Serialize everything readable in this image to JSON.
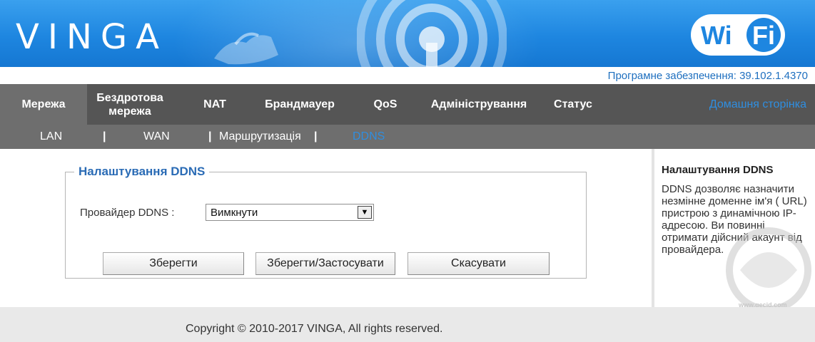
{
  "header": {
    "logo": "VINGA",
    "wifi_left": "Wi",
    "wifi_right": "Fi"
  },
  "version": "Програмне забезпечення: 39.102.1.4370",
  "nav": {
    "items": [
      {
        "label": "Мережа"
      },
      {
        "label": "Бездротова мережа"
      },
      {
        "label": "NAT"
      },
      {
        "label": "Брандмауер"
      },
      {
        "label": "QoS"
      },
      {
        "label": "Адміністрування"
      },
      {
        "label": "Статус"
      }
    ],
    "home": "Домашня сторінка"
  },
  "subnav": {
    "items": [
      {
        "label": "LAN"
      },
      {
        "label": "WAN"
      },
      {
        "label": "Маршрутизація"
      },
      {
        "label": "DDNS"
      }
    ],
    "separator": "|"
  },
  "form": {
    "legend": "Налаштування DDNS",
    "provider_label": "Провайдер DDNS :",
    "provider_value": "Вимкнути",
    "save": "Зберегти",
    "save_apply": "Зберегти/Застосувати",
    "cancel": "Скасувати"
  },
  "help": {
    "title": "Налаштування DDNS",
    "text": "DDNS дозволяє назначити незмінне доменне ім'я ( URL) пристрою з динамічною IP-адресою. Ви повинні отримати дійсний акаунт від провайдера.",
    "watermark_sub": "www.gecid.com"
  },
  "footer": {
    "copyright": "Copyright © 2010-2017 VINGA, All rights reserved."
  },
  "colors": {
    "banner": "#1e86e0",
    "nav_bg": "#555555",
    "subnav_bg": "#6e6e6e",
    "accent_link": "#2f8ee0",
    "legend": "#2a6bb5"
  }
}
